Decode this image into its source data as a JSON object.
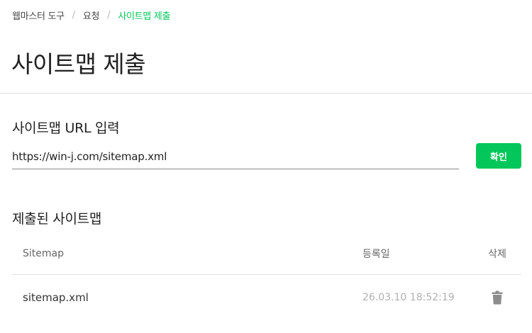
{
  "breadcrumb": {
    "items": [
      "웹마스터 도구",
      "요청"
    ],
    "current": "사이트맵 제출",
    "separator": "/"
  },
  "page_title": "사이트맵 제출",
  "input_section": {
    "heading": "사이트맵 URL 입력",
    "url_value": "https://win-j.com/sitemap.xml",
    "confirm_label": "확인"
  },
  "submitted_section": {
    "heading": "제출된 사이트맵",
    "columns": {
      "sitemap": "Sitemap",
      "date": "등록일",
      "delete": "삭제"
    },
    "rows": [
      {
        "sitemap": "sitemap.xml",
        "date": "26.03.10 18:52:19",
        "delete_icon": "trash-icon"
      }
    ]
  },
  "colors": {
    "accent": "#03c75a",
    "text": "#222222",
    "muted": "#b0b0b0",
    "divider": "#dcdcdc"
  }
}
